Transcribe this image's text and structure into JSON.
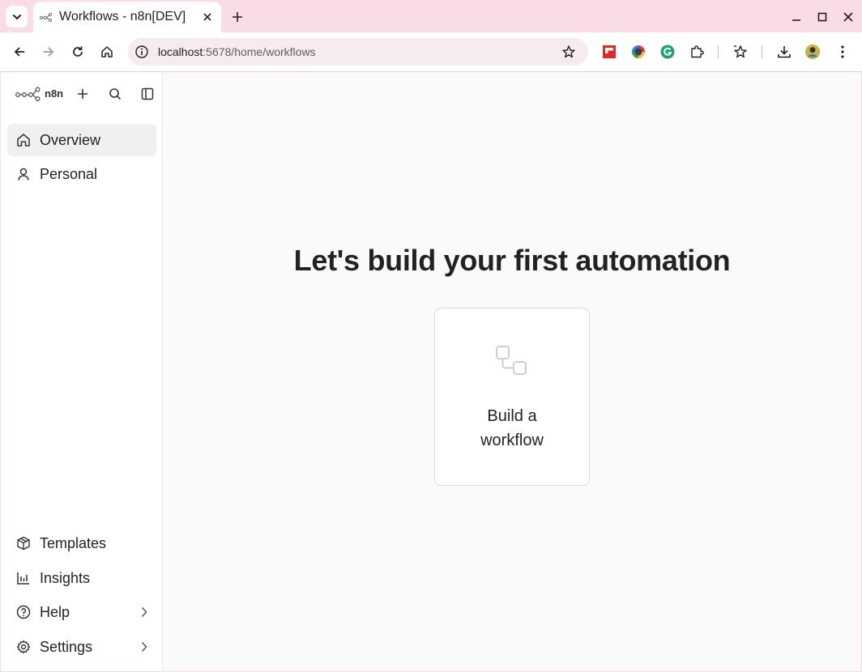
{
  "browser": {
    "tab_title": "Workflows - n8n[DEV]",
    "url_host": "localhost",
    "url_rest": ":5678/home/workflows",
    "colors": {
      "chrome": "#fadbe8",
      "omnibox": "#f6ebf0"
    }
  },
  "sidebar": {
    "logo_text": "n8n",
    "nav_top": [
      {
        "label": "Overview",
        "icon": "home-icon",
        "active": true
      },
      {
        "label": "Personal",
        "icon": "user-icon",
        "active": false
      }
    ],
    "nav_bottom": [
      {
        "label": "Templates",
        "icon": "box-icon"
      },
      {
        "label": "Insights",
        "icon": "bar-chart-icon"
      },
      {
        "label": "Help",
        "icon": "help-circle-icon",
        "has_submenu": true
      },
      {
        "label": "Settings",
        "icon": "gear-icon",
        "has_submenu": true
      }
    ]
  },
  "main": {
    "headline": "Let's build your first automation",
    "card": {
      "line1": "Build a",
      "line2": "workflow",
      "icon": "workflow-nodes-icon"
    }
  }
}
